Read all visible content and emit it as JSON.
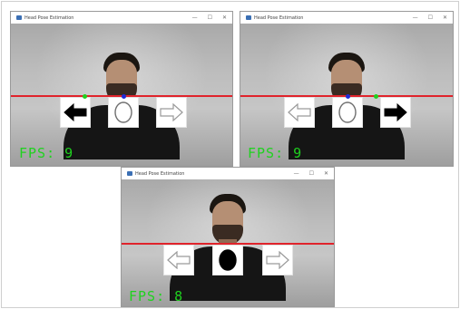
{
  "windows": [
    {
      "title": "Head Pose Estimation",
      "controls": {
        "minimize": "—",
        "maximize": "☐",
        "close": "✕"
      },
      "fps_text": "FPS: 9",
      "left_arrow": "filled",
      "center": "outline",
      "right_arrow": "outline"
    },
    {
      "title": "Head Pose Estimation",
      "controls": {
        "minimize": "—",
        "maximize": "☐",
        "close": "✕"
      },
      "fps_text": "FPS: 9",
      "left_arrow": "outline",
      "center": "outline",
      "right_arrow": "filled"
    },
    {
      "title": "Head Pose Estimation",
      "controls": {
        "minimize": "—",
        "maximize": "☐",
        "close": "✕"
      },
      "fps_text": "FPS: 8",
      "left_arrow": "outline",
      "center": "filled",
      "right_arrow": "outline"
    }
  ],
  "colors": {
    "guide_line": "#e0232b",
    "fps_text": "#1fd21f",
    "landmark_blue": "#1f2bd6",
    "landmark_green": "#1fd21f"
  },
  "icons": {
    "left_arrow": "arrow-left-icon",
    "right_arrow": "arrow-right-icon",
    "center": "head-oval-icon"
  }
}
